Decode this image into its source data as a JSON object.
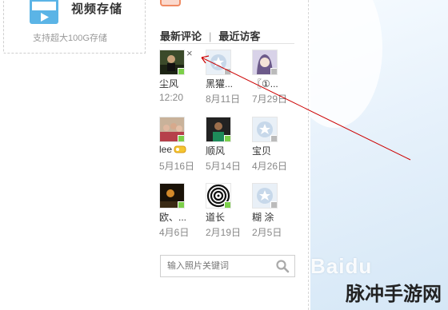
{
  "video_card": {
    "title": "视频存储",
    "subtitle": "支持超大100G存储"
  },
  "tabs": {
    "latest_comments": "最新评论",
    "separator": "|",
    "recent_visitors": "最近访客"
  },
  "visitors": [
    {
      "name": "尘风",
      "date": "12:20",
      "status": "online",
      "avatar": "photo-dark",
      "removable": true
    },
    {
      "name": "黑獾...",
      "date": "8月11日",
      "status": "offline",
      "avatar": "default-star"
    },
    {
      "name": "〖①...",
      "date": "7月29日",
      "status": "offline",
      "avatar": "anime-girl"
    },
    {
      "name": "lee",
      "date": "5月16日",
      "status": "online",
      "avatar": "group-photo",
      "badge": "vip-icon"
    },
    {
      "name": "顺风",
      "date": "5月14日",
      "status": "online",
      "avatar": "person-photo"
    },
    {
      "name": "宝贝",
      "date": "4月26日",
      "status": "offline",
      "avatar": "default-star"
    },
    {
      "name": "欧、...",
      "date": "4月6日",
      "status": "online",
      "avatar": "night-photo"
    },
    {
      "name": "道长",
      "date": "2月19日",
      "status": "online",
      "avatar": "spiral"
    },
    {
      "name": "糊 涂",
      "date": "2月5日",
      "status": "offline",
      "avatar": "default-star"
    }
  ],
  "search": {
    "placeholder": "输入照片关键词"
  },
  "watermark": "Baidu",
  "brand": "脉冲手游网",
  "colors": {
    "accent": "#cc0000",
    "online": "#7ccf4a",
    "link": "#333333"
  }
}
